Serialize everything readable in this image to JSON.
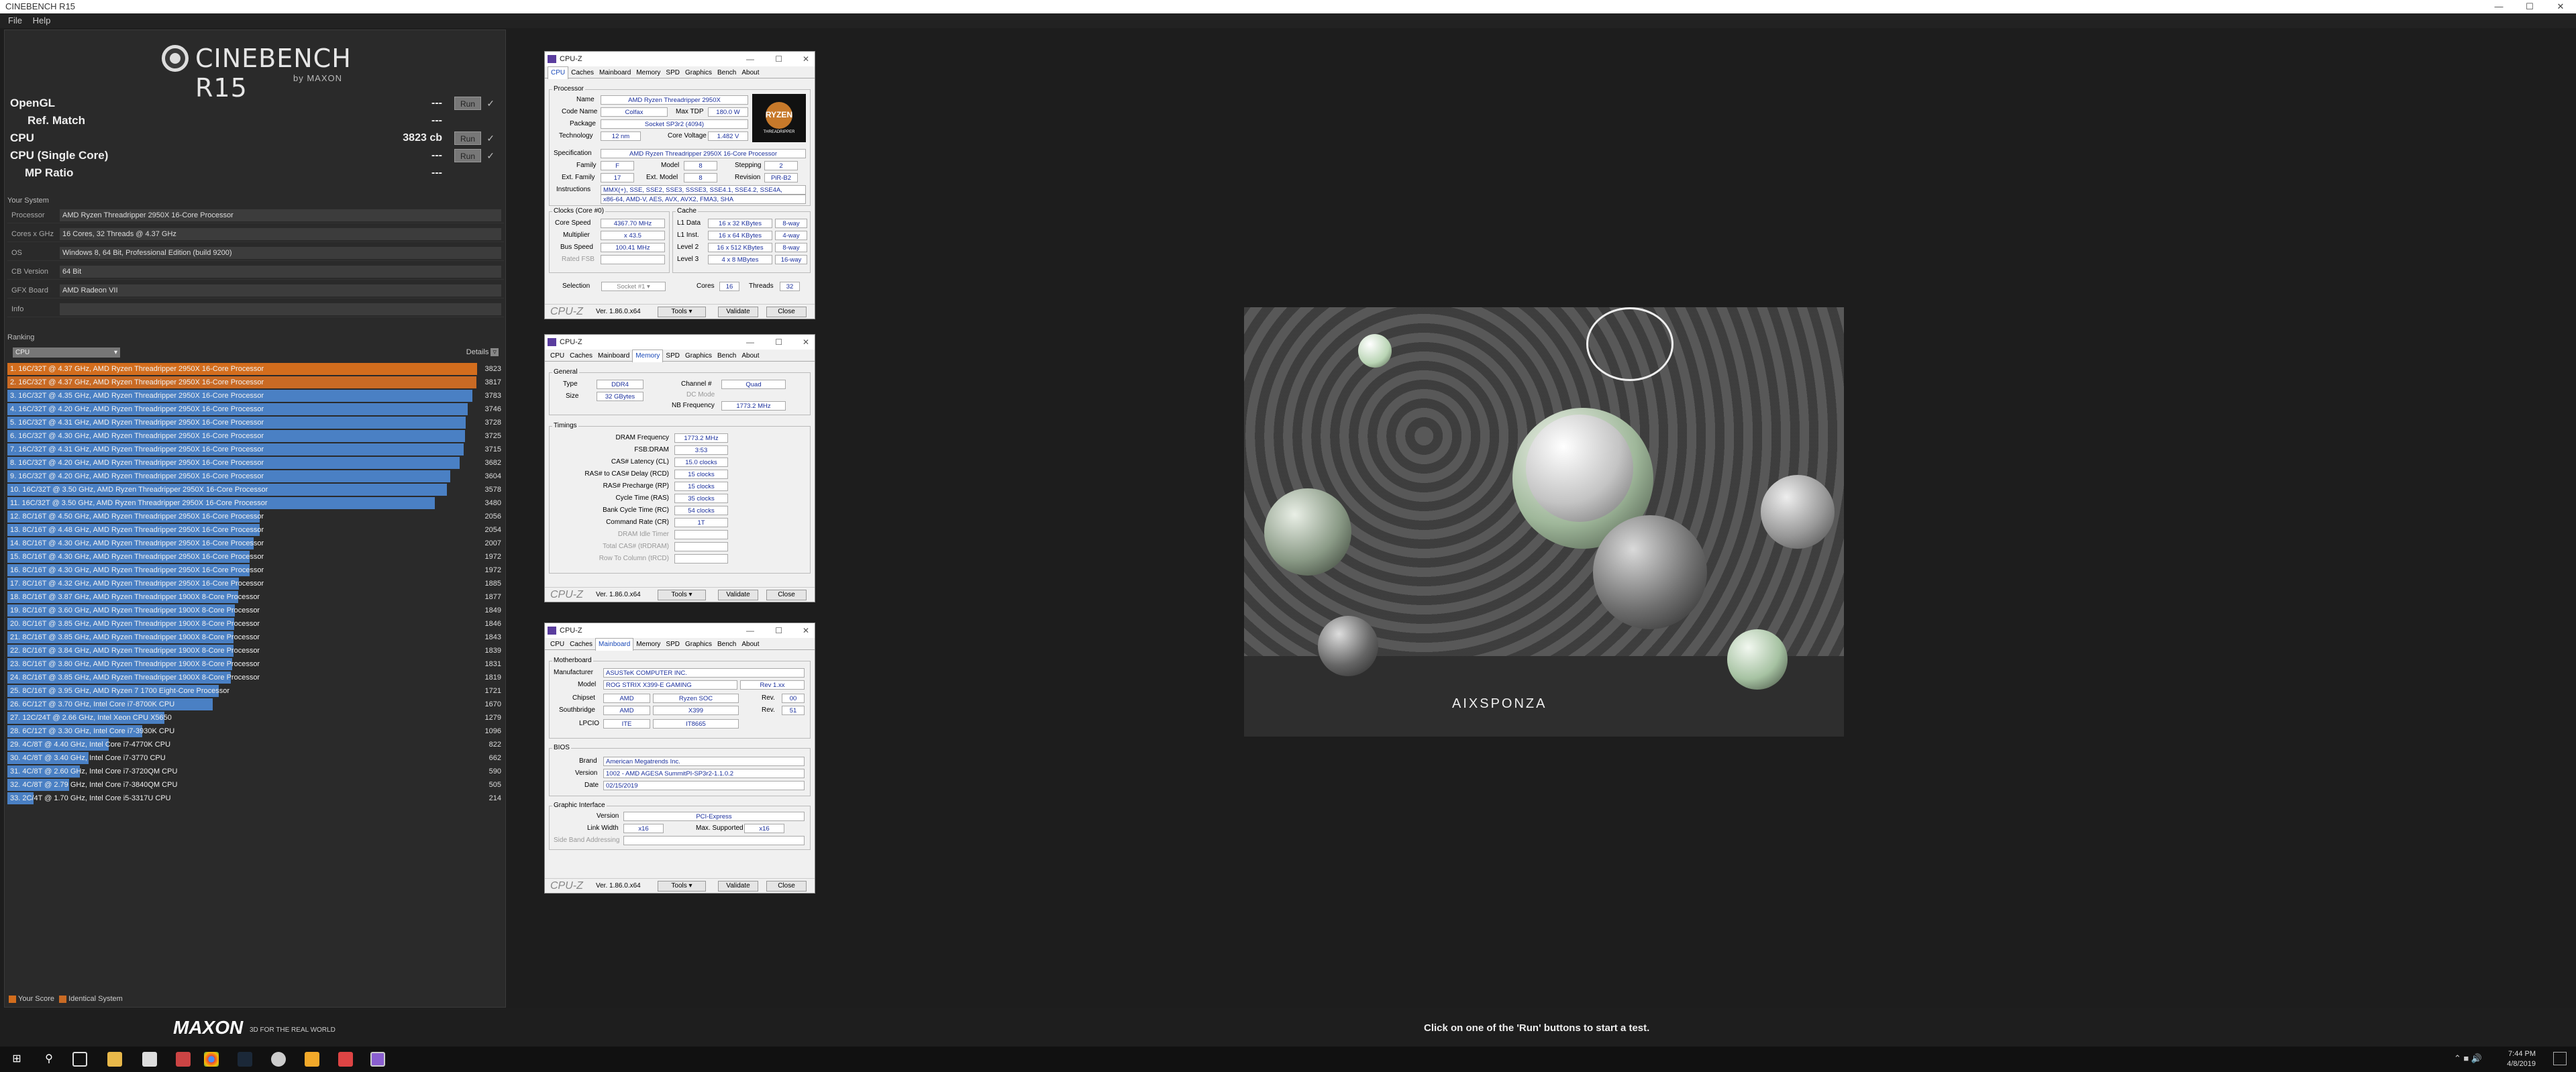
{
  "window": {
    "title": "CINEBENCH R15"
  },
  "menu": [
    "File",
    "Help"
  ],
  "logo": {
    "title": "CINEBENCH R15",
    "sub": "by MAXON"
  },
  "benchmarks": [
    {
      "name": "OpenGL",
      "value": "---",
      "run": "Run"
    },
    {
      "name": "Ref. Match",
      "value": "---"
    },
    {
      "name": "CPU",
      "value": "3823 cb",
      "run": "Run"
    },
    {
      "name": "CPU (Single Core)",
      "value": "---",
      "run": "Run"
    },
    {
      "name": "MP Ratio",
      "value": "---"
    }
  ],
  "system": {
    "title": "Your System",
    "rows": [
      {
        "k": "Processor",
        "v": "AMD Ryzen Threadripper 2950X 16-Core Processor"
      },
      {
        "k": "Cores x GHz",
        "v": "16 Cores, 32 Threads @ 4.37 GHz"
      },
      {
        "k": "OS",
        "v": "Windows 8, 64 Bit, Professional Edition (build 9200)"
      },
      {
        "k": "CB Version",
        "v": "64 Bit"
      },
      {
        "k": "GFX Board",
        "v": "AMD Radeon VII"
      },
      {
        "k": "Info",
        "v": ""
      }
    ]
  },
  "ranking": {
    "title": "Ranking",
    "dropdown": "CPU",
    "details": "Details",
    "max": 3823,
    "items": [
      {
        "label": "1. 16C/32T @ 4.37 GHz, AMD Ryzen Threadripper 2950X 16-Core Processor",
        "score": 3823,
        "kind": "mine"
      },
      {
        "label": "2. 16C/32T @ 4.37 GHz, AMD Ryzen Threadripper 2950X 16-Core Processor",
        "score": 3817,
        "kind": "ident"
      },
      {
        "label": "3. 16C/32T @ 4.35 GHz, AMD Ryzen Threadripper 2950X 16-Core Processor",
        "score": 3783,
        "kind": "other"
      },
      {
        "label": "4. 16C/32T @ 4.20 GHz, AMD Ryzen Threadripper 2950X 16-Core Processor",
        "score": 3746,
        "kind": "other"
      },
      {
        "label": "5. 16C/32T @ 4.31 GHz, AMD Ryzen Threadripper 2950X 16-Core Processor",
        "score": 3728,
        "kind": "other"
      },
      {
        "label": "6. 16C/32T @ 4.30 GHz, AMD Ryzen Threadripper 2950X 16-Core Processor",
        "score": 3725,
        "kind": "other"
      },
      {
        "label": "7. 16C/32T @ 4.31 GHz, AMD Ryzen Threadripper 2950X 16-Core Processor",
        "score": 3715,
        "kind": "other"
      },
      {
        "label": "8. 16C/32T @ 4.20 GHz, AMD Ryzen Threadripper 2950X 16-Core Processor",
        "score": 3682,
        "kind": "other"
      },
      {
        "label": "9. 16C/32T @ 4.20 GHz, AMD Ryzen Threadripper 2950X 16-Core Processor",
        "score": 3604,
        "kind": "other"
      },
      {
        "label": "10. 16C/32T @ 3.50 GHz, AMD Ryzen Threadripper 2950X 16-Core Processor",
        "score": 3578,
        "kind": "other"
      },
      {
        "label": "11. 16C/32T @ 3.50 GHz, AMD Ryzen Threadripper 2950X 16-Core Processor",
        "score": 3480,
        "kind": "other"
      },
      {
        "label": "12. 8C/16T @ 4.50 GHz, AMD Ryzen Threadripper 2950X 16-Core Processor",
        "score": 2056,
        "kind": "other"
      },
      {
        "label": "13. 8C/16T @ 4.48 GHz, AMD Ryzen Threadripper 2950X 16-Core Processor",
        "score": 2054,
        "kind": "other"
      },
      {
        "label": "14. 8C/16T @ 4.30 GHz, AMD Ryzen Threadripper 2950X 16-Core Processor",
        "score": 2007,
        "kind": "other"
      },
      {
        "label": "15. 8C/16T @ 4.30 GHz, AMD Ryzen Threadripper 2950X 16-Core Processor",
        "score": 1972,
        "kind": "other"
      },
      {
        "label": "16. 8C/16T @ 4.30 GHz, AMD Ryzen Threadripper 2950X 16-Core Processor",
        "score": 1972,
        "kind": "other"
      },
      {
        "label": "17. 8C/16T @ 4.32 GHz, AMD Ryzen Threadripper 2950X 16-Core Processor",
        "score": 1885,
        "kind": "other"
      },
      {
        "label": "18. 8C/16T @ 3.87 GHz, AMD Ryzen Threadripper 1900X 8-Core Processor",
        "score": 1877,
        "kind": "other"
      },
      {
        "label": "19. 8C/16T @ 3.60 GHz, AMD Ryzen Threadripper 1900X 8-Core Processor",
        "score": 1849,
        "kind": "other"
      },
      {
        "label": "20. 8C/16T @ 3.85 GHz, AMD Ryzen Threadripper 1900X 8-Core Processor",
        "score": 1846,
        "kind": "other"
      },
      {
        "label": "21. 8C/16T @ 3.85 GHz, AMD Ryzen Threadripper 1900X 8-Core Processor",
        "score": 1843,
        "kind": "other"
      },
      {
        "label": "22. 8C/16T @ 3.84 GHz, AMD Ryzen Threadripper 1900X 8-Core Processor",
        "score": 1839,
        "kind": "other"
      },
      {
        "label": "23. 8C/16T @ 3.80 GHz, AMD Ryzen Threadripper 1900X 8-Core Processor",
        "score": 1831,
        "kind": "other"
      },
      {
        "label": "24. 8C/16T @ 3.85 GHz, AMD Ryzen Threadripper 1900X 8-Core Processor",
        "score": 1819,
        "kind": "other"
      },
      {
        "label": "25. 8C/16T @ 3.95 GHz, AMD Ryzen 7 1700 Eight-Core Processor",
        "score": 1721,
        "kind": "other"
      },
      {
        "label": "26. 6C/12T @ 3.70 GHz, Intel Core i7-8700K CPU",
        "score": 1670,
        "kind": "other"
      },
      {
        "label": "27. 12C/24T @ 2.66 GHz, Intel Xeon CPU X5650",
        "score": 1279,
        "kind": "other"
      },
      {
        "label": "28. 6C/12T @ 3.30 GHz, Intel Core i7-3930K CPU",
        "score": 1096,
        "kind": "other"
      },
      {
        "label": "29. 4C/8T @ 4.40 GHz, Intel Core i7-4770K CPU",
        "score": 822,
        "kind": "other"
      },
      {
        "label": "30. 4C/8T @ 3.40 GHz, Intel Core i7-3770 CPU",
        "score": 662,
        "kind": "other"
      },
      {
        "label": "31. 4C/8T @ 2.60 GHz, Intel Core i7-3720QM CPU",
        "score": 590,
        "kind": "other"
      },
      {
        "label": "32. 4C/8T @ 2.79 GHz, Intel Core i7-3840QM CPU",
        "score": 505,
        "kind": "other"
      },
      {
        "label": "33. 2C/4T @ 1.70 GHz, Intel Core i5-3317U CPU",
        "score": 214,
        "kind": "other"
      }
    ]
  },
  "legend": {
    "mine": "Your Score",
    "ident": "Identical System",
    "mine_color": "#d36d1d",
    "ident_color": "#c96a24"
  },
  "cpuz_common": {
    "title": "CPU-Z",
    "brand": "CPU-Z",
    "version": "Ver. 1.86.0.x64",
    "tools": "Tools",
    "validate": "Validate",
    "close": "Close",
    "tabs": [
      "CPU",
      "Caches",
      "Mainboard",
      "Memory",
      "SPD",
      "Graphics",
      "Bench",
      "About"
    ]
  },
  "cpuz_cpu": {
    "group_processor": "Processor",
    "name_k": "Name",
    "name_v": "AMD Ryzen Threadripper 2950X",
    "code_k": "Code Name",
    "code_v": "Colfax",
    "tdp_k": "Max TDP",
    "tdp_v": "180.0 W",
    "pkg_k": "Package",
    "pkg_v": "Socket SP3r2 (4094)",
    "tech_k": "Technology",
    "tech_v": "12 nm",
    "volt_k": "Core Voltage",
    "volt_v": "1.482 V",
    "spec_k": "Specification",
    "spec_v": "AMD Ryzen Threadripper 2950X 16-Core Processor",
    "fam_k": "Family",
    "fam_v": "F",
    "model_k": "Model",
    "model_v": "8",
    "step_k": "Stepping",
    "step_v": "2",
    "efam_k": "Ext. Family",
    "efam_v": "17",
    "emodel_k": "Ext. Model",
    "emodel_v": "8",
    "rev_k": "Revision",
    "rev_v": "PiR-B2",
    "instr_k": "Instructions",
    "instr_v1": "MMX(+), SSE, SSE2, SSE3, SSSE3, SSE4.1, SSE4.2, SSE4A,",
    "instr_v2": "x86-64, AMD-V, AES, AVX, AVX2, FMA3, SHA",
    "group_clocks": "Clocks (Core #0)",
    "group_cache": "Cache",
    "cs_k": "Core Speed",
    "cs_v": "4367.70 MHz",
    "mul_k": "Multiplier",
    "mul_v": "x 43.5",
    "bus_k": "Bus Speed",
    "bus_v": "100.41 MHz",
    "fsb_k": "Rated FSB",
    "l1d_k": "L1 Data",
    "l1d_v": "16 x 32 KBytes",
    "l1d_w": "8-way",
    "l1i_k": "L1 Inst.",
    "l1i_v": "16 x 64 KBytes",
    "l1i_w": "4-way",
    "l2_k": "Level 2",
    "l2_v": "16 x 512 KBytes",
    "l2_w": "8-way",
    "l3_k": "Level 3",
    "l3_v": "4 x 8 MBytes",
    "l3_w": "16-way",
    "sel_k": "Selection",
    "sel_v": "Socket #1",
    "cores_k": "Cores",
    "cores_v": "16",
    "thr_k": "Threads",
    "thr_v": "32",
    "badge1": "RYZEN",
    "badge2": "THREADRIPPER"
  },
  "cpuz_mem": {
    "group_general": "General",
    "type_k": "Type",
    "type_v": "DDR4",
    "size_k": "Size",
    "size_v": "32 GBytes",
    "ch_k": "Channel #",
    "ch_v": "Quad",
    "dc_k": "DC Mode",
    "nb_k": "NB Frequency",
    "nb_v": "1773.2 MHz",
    "group_timings": "Timings",
    "rows": [
      {
        "k": "DRAM Frequency",
        "v": "1773.2 MHz"
      },
      {
        "k": "FSB:DRAM",
        "v": "3:53"
      },
      {
        "k": "CAS# Latency (CL)",
        "v": "15.0 clocks"
      },
      {
        "k": "RAS# to CAS# Delay (RCD)",
        "v": "15 clocks"
      },
      {
        "k": "RAS# Precharge (RP)",
        "v": "15 clocks"
      },
      {
        "k": "Cycle Time (RAS)",
        "v": "35 clocks"
      },
      {
        "k": "Bank Cycle Time (RC)",
        "v": "54 clocks"
      },
      {
        "k": "Command Rate (CR)",
        "v": "1T"
      },
      {
        "k": "DRAM Idle Timer",
        "v": ""
      },
      {
        "k": "Total CAS# (tRDRAM)",
        "v": ""
      },
      {
        "k": "Row To Column (tRCD)",
        "v": ""
      }
    ]
  },
  "cpuz_mb": {
    "group_mb": "Motherboard",
    "man_k": "Manufacturer",
    "man_v": "ASUSTeK COMPUTER INC.",
    "model_k": "Model",
    "model_v": "ROG STRIX X399-E GAMING",
    "model_rev": "Rev 1.xx",
    "chip_k": "Chipset",
    "chip_v1": "AMD",
    "chip_v2": "Ryzen SOC",
    "chip_rk": "Rev.",
    "chip_rv": "00",
    "sb_k": "Southbridge",
    "sb_v1": "AMD",
    "sb_v2": "X399",
    "sb_rk": "Rev.",
    "sb_rv": "51",
    "lpc_k": "LPCIO",
    "lpc_v1": "ITE",
    "lpc_v2": "IT8665",
    "group_bios": "BIOS",
    "brand_k": "Brand",
    "brand_v": "American Megatrends Inc.",
    "ver_k": "Version",
    "ver_v": "1002 - AMD AGESA SummitPI-SP3r2-1.1.0.2",
    "date_k": "Date",
    "date_v": "02/15/2019",
    "group_gi": "Graphic Interface",
    "giv_k": "Version",
    "giv_v": "PCI-Express",
    "lw_k": "Link Width",
    "lw_v": "x16",
    "ms_k": "Max. Supported",
    "ms_v": "x16",
    "sba_k": "Side Band Addressing"
  },
  "render": {
    "brand": "AIXSPONZA"
  },
  "status": {
    "brand": "MAXON",
    "tagline": "3D FOR THE REAL WORLD",
    "message": "Click on one of the 'Run' buttons to start a test."
  },
  "clock": {
    "time": "7:44 PM",
    "date": "4/8/2019"
  }
}
